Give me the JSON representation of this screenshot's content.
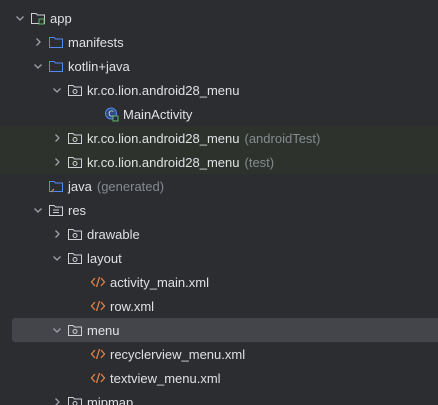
{
  "tree": {
    "items": [
      {
        "label": "app",
        "hint": ""
      },
      {
        "label": "manifests",
        "hint": ""
      },
      {
        "label": "kotlin+java",
        "hint": ""
      },
      {
        "label": "kr.co.lion.android28_menu",
        "hint": ""
      },
      {
        "label": "MainActivity",
        "hint": ""
      },
      {
        "label": "kr.co.lion.android28_menu",
        "hint": "(androidTest)"
      },
      {
        "label": "kr.co.lion.android28_menu",
        "hint": "(test)"
      },
      {
        "label": "java",
        "hint": "(generated)"
      },
      {
        "label": "res",
        "hint": ""
      },
      {
        "label": "drawable",
        "hint": ""
      },
      {
        "label": "layout",
        "hint": ""
      },
      {
        "label": "activity_main.xml",
        "hint": ""
      },
      {
        "label": "row.xml",
        "hint": ""
      },
      {
        "label": "menu",
        "hint": ""
      },
      {
        "label": "recyclerview_menu.xml",
        "hint": ""
      },
      {
        "label": "textview_menu.xml",
        "hint": ""
      },
      {
        "label": "mipmap",
        "hint": ""
      }
    ]
  },
  "colors": {
    "background": "#2b2d30",
    "selected_row": "#43454a",
    "test_row": "#2d332c",
    "folder_blue": "#548af7",
    "xml_orange": "#e0834a",
    "hint_gray": "#868a91"
  }
}
